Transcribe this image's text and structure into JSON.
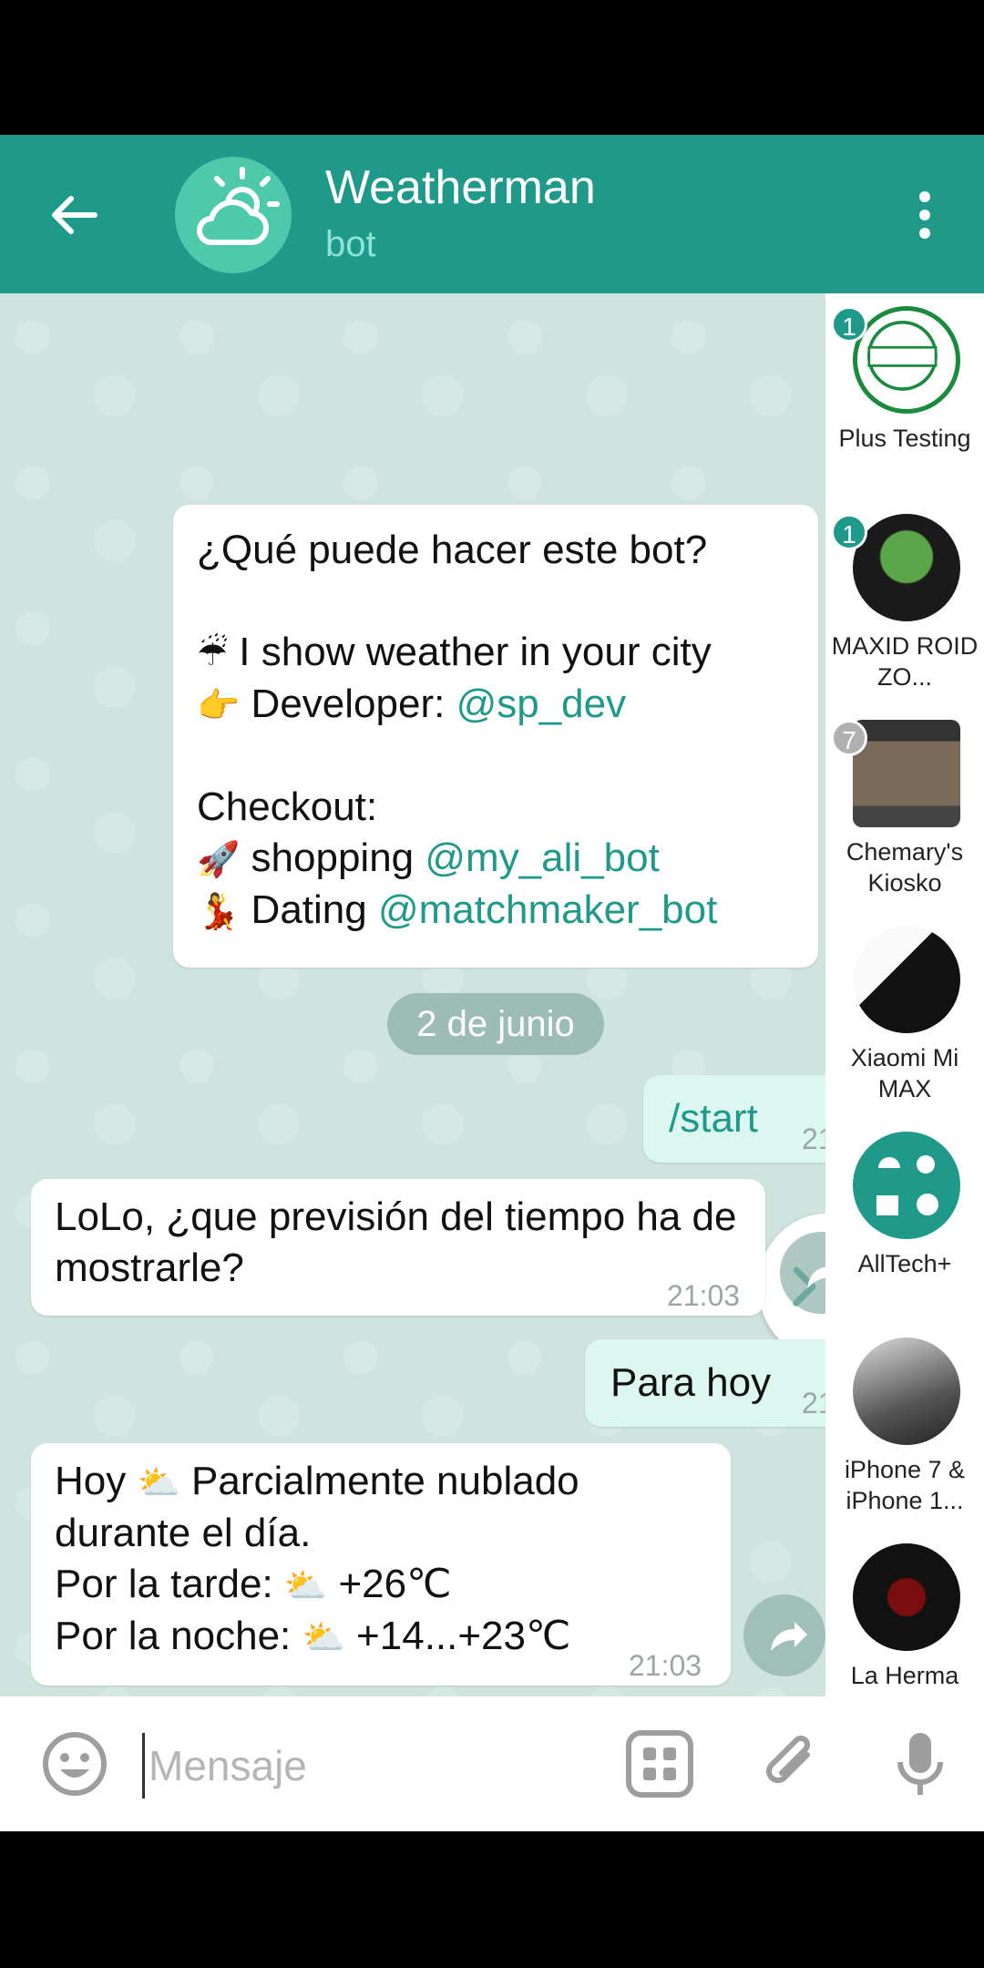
{
  "header": {
    "title": "Weatherman",
    "subtitle": "bot"
  },
  "messages": {
    "intro": {
      "line1": "¿Qué puede hacer este bot?",
      "line2_emoji": "☔",
      "line2": " I show weather in your city",
      "line3_emoji": "👉",
      "line3_prefix": " Developer: ",
      "line3_mention": "@sp_dev",
      "line4": "Checkout:",
      "line5_emoji": "🚀",
      "line5_prefix": " shopping ",
      "line5_mention": "@my_ali_bot",
      "line6_emoji": "💃",
      "line6_prefix": " Dating ",
      "line6_mention": "@matchmaker_bot"
    },
    "date_chip": "2 de junio",
    "out1": {
      "text": "/start",
      "time": "21"
    },
    "in1": {
      "text": "LoLo, ¿que previsión del tiempo ha de mostrarle?",
      "time": "21:03"
    },
    "out2": {
      "text": "Para hoy",
      "time": "21"
    },
    "in2": {
      "l1a": "Hoy ",
      "l1_emoji": "⛅",
      "l1b": " Parcialmente nublado",
      "l2": "durante el día.",
      "l3a": "Por la tarde: ",
      "l3_emoji": "⛅",
      "l3b": " +26℃",
      "l4a": "Por la noche: ",
      "l4_emoji": "⛅",
      "l4b": " +14...+23℃",
      "time": "21:03"
    }
  },
  "sidebar": {
    "items": [
      {
        "name": "Plus Testing",
        "badge": "1",
        "badge_color": "#1f9a8a"
      },
      {
        "name": "MAXID ROID ZO...",
        "badge": "1",
        "badge_color": "#1f9a8a"
      },
      {
        "name": "Chemary's Kiosko",
        "badge": "7",
        "badge_color": "#b0b0b0"
      },
      {
        "name": "Xiaomi Mi MAX"
      },
      {
        "name": "AllTech+"
      },
      {
        "name": "iPhone 7 & iPhone 1..."
      },
      {
        "name": "La Herma"
      }
    ]
  },
  "input": {
    "placeholder": "Mensaje"
  },
  "colors": {
    "accent": "#1f9a8a",
    "chat_bg": "#cfe4df",
    "out_bubble": "#dcf6f0"
  }
}
